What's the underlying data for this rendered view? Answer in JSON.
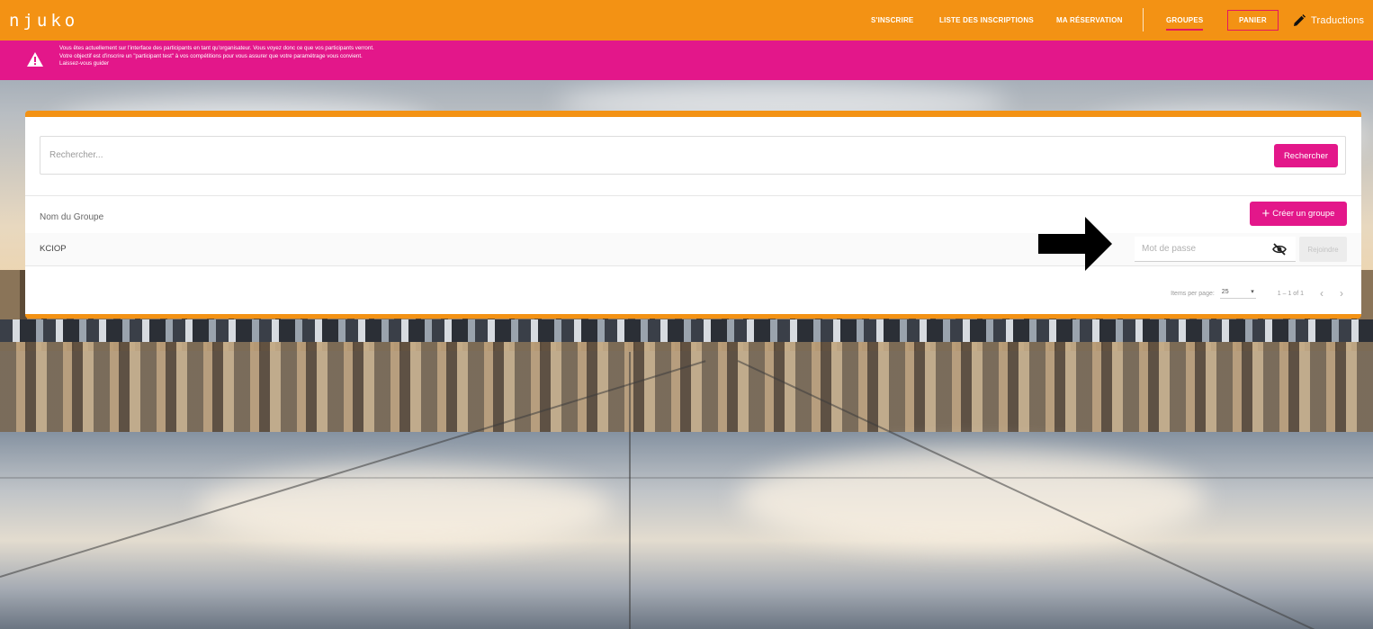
{
  "app": {
    "logo": "njuko"
  },
  "nav": {
    "items": [
      {
        "label": "S'INSCRIRE"
      },
      {
        "label": "LISTE DES INSCRIPTIONS"
      },
      {
        "label": "MA RÉSERVATION"
      },
      {
        "label": "GROUPES"
      },
      {
        "label": "PANIER"
      },
      {
        "label": "Traductions"
      }
    ],
    "active": "GROUPES"
  },
  "banner": {
    "line1": "Vous êtes actuellement sur l'interface des participants en tant qu'organisateur. Vous voyez donc ce que vos participants verront.",
    "line2": "Votre objectif est d'inscrire un \"participant test\" à vos compétitions pour vous assurer que votre paramétrage vous convient.",
    "line3": "Laissez-vous guider"
  },
  "search": {
    "placeholder": "Rechercher...",
    "button": "Rechercher"
  },
  "table": {
    "header_name": "Nom du Groupe",
    "create_button": "Créer un groupe",
    "rows": [
      {
        "name": "KCIOP",
        "password_placeholder": "Mot de passe",
        "join_button": "Rejoindre"
      }
    ]
  },
  "pager": {
    "items_label": "Items per page:",
    "items_value": "25",
    "range": "1 – 1 of 1"
  },
  "colors": {
    "brand_orange": "#f39214",
    "accent_pink": "#e3178a"
  }
}
